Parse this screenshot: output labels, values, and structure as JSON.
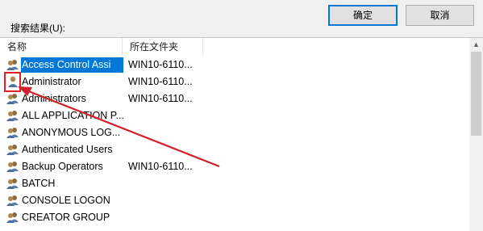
{
  "dialog": {
    "results_label": "搜索结果(U):",
    "ok_button": "确定",
    "cancel_button": "取消"
  },
  "table": {
    "columns": [
      "名称",
      "所在文件夹"
    ],
    "rows": [
      {
        "name": "Access Control Assi",
        "folder": "WIN10-6110...",
        "icon": "group-icon",
        "selected": true
      },
      {
        "name": "Administrator",
        "folder": "WIN10-6110...",
        "icon": "user-icon",
        "selected": false
      },
      {
        "name": "Administrators",
        "folder": "WIN10-6110...",
        "icon": "group-icon",
        "selected": false
      },
      {
        "name": "ALL APPLICATION P...",
        "folder": "",
        "icon": "group-icon",
        "selected": false
      },
      {
        "name": "ANONYMOUS LOG...",
        "folder": "",
        "icon": "group-icon",
        "selected": false
      },
      {
        "name": "Authenticated Users",
        "folder": "",
        "icon": "group-icon",
        "selected": false
      },
      {
        "name": "Backup Operators",
        "folder": "WIN10-6110...",
        "icon": "group-icon",
        "selected": false
      },
      {
        "name": "BATCH",
        "folder": "",
        "icon": "group-icon",
        "selected": false
      },
      {
        "name": "CONSOLE LOGON",
        "folder": "",
        "icon": "group-icon",
        "selected": false
      },
      {
        "name": "CREATOR GROUP",
        "folder": "",
        "icon": "group-icon",
        "selected": false
      }
    ]
  },
  "annotation": {
    "highlight_color": "#e02020",
    "arrow_color": "#d0202a"
  }
}
